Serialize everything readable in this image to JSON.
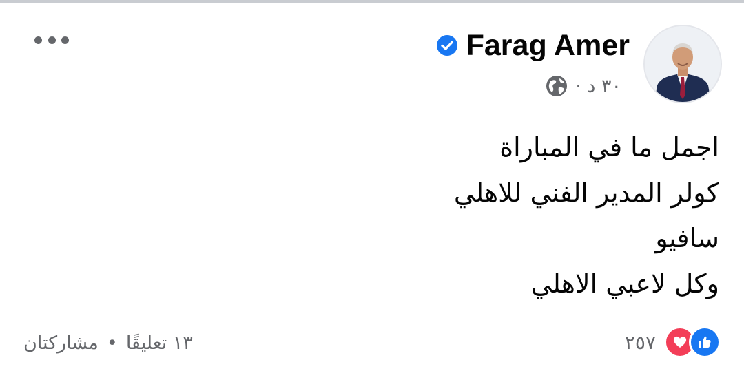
{
  "post": {
    "author": {
      "name": "Farag Amer",
      "verified": true,
      "avatar_icon": "profile-photo"
    },
    "timestamp": "٣٠ د ·",
    "audience_icon": "globe-icon",
    "lines": [
      "اجمل ما في المباراة",
      "كولر المدير الفني للاهلي",
      "سافيو",
      "وكل لاعبي الاهلي"
    ]
  },
  "engagement": {
    "reactions_count": "٢٥٧",
    "reaction_icons": [
      "like-icon",
      "love-icon"
    ],
    "comments": "١٣ تعليقًا",
    "separator": "•",
    "shares": "مشاركتان"
  },
  "menu": {
    "icon": "more-options-icon"
  },
  "colors": {
    "like": "#1877f2",
    "love": "#f33e58",
    "verified": "#1877f2",
    "secondary_text": "#65676b",
    "primary_text": "#050505"
  }
}
